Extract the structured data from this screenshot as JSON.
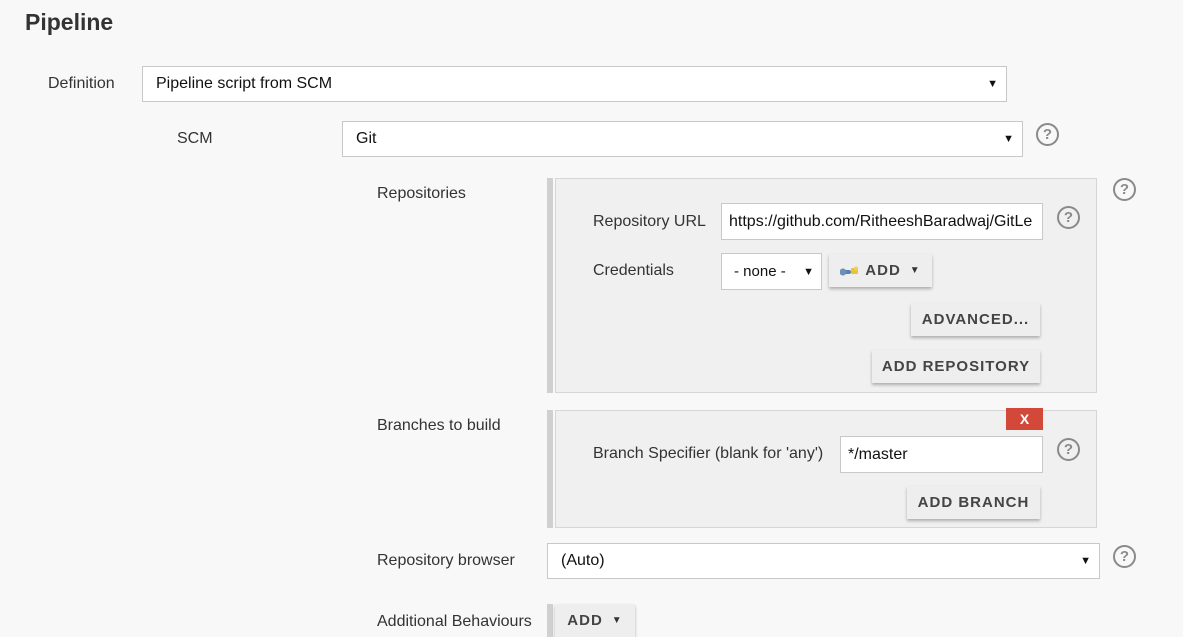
{
  "section_title": "Pipeline",
  "definition": {
    "label": "Definition",
    "value": "Pipeline script from SCM"
  },
  "scm": {
    "label": "SCM",
    "value": "Git"
  },
  "repositories": {
    "label": "Repositories",
    "repository_url_label": "Repository URL",
    "repository_url_value": "https://github.com/RitheeshBaradwaj/GitLe",
    "credentials_label": "Credentials",
    "credentials_value": "- none -",
    "add_label": "ADD",
    "advanced_label": "ADVANCED...",
    "add_repository_label": "ADD REPOSITORY"
  },
  "branches": {
    "label": "Branches to build",
    "delete_label": "X",
    "specifier_label": "Branch Specifier (blank for 'any')",
    "specifier_value": "*/master",
    "add_branch_label": "ADD BRANCH"
  },
  "repository_browser": {
    "label": "Repository browser",
    "value": "(Auto)"
  },
  "additional_behaviours": {
    "label": "Additional Behaviours",
    "add_label": "ADD"
  },
  "help_glyph": "?",
  "caret_glyph": "▼",
  "colors": {
    "delete_button": "#d24939",
    "background": "#f8f8f8",
    "panel": "#f0f0f0"
  },
  "icons": [
    "help-icon",
    "key-icon",
    "dropdown-caret-icon"
  ]
}
